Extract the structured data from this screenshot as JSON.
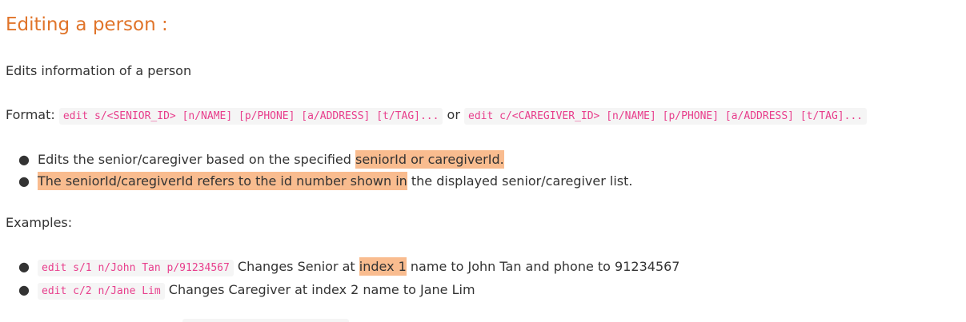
{
  "heading": "Editing a person :",
  "description": "Edits information of a person",
  "format": {
    "label": "Format: ",
    "command_senior": "edit s/<SENIOR_ID> [n/NAME] [p/PHONE] [a/ADDRESS] [t/TAG]...",
    "separator": " or ",
    "command_caregiver": "edit c/<CAREGIVER_ID> [n/NAME] [p/PHONE] [a/ADDRESS] [t/TAG]..."
  },
  "notes": [
    {
      "plain": "Edits the senior/caregiver based on the specified ",
      "highlight": "seniorId or caregiverId."
    },
    {
      "highlight": "The seniorId/caregiverId refers to the id number shown in",
      "plain": " the displayed senior/caregiver list."
    }
  ],
  "examples_label": "Examples:",
  "examples": [
    {
      "code": "edit s/1 n/John Tan p/91234567",
      "text_before": " Changes Senior at ",
      "highlight": "index 1",
      "text_after": " name to John Tan and phone to 91234567"
    },
    {
      "code": "edit c/2 n/Jane Lim",
      "text": " Changes Caregiver at index 2 name to Jane Lim"
    }
  ],
  "highlight_color": "#f9bc8f",
  "heading_color": "#e0742a",
  "code_color": "#e83e8c"
}
